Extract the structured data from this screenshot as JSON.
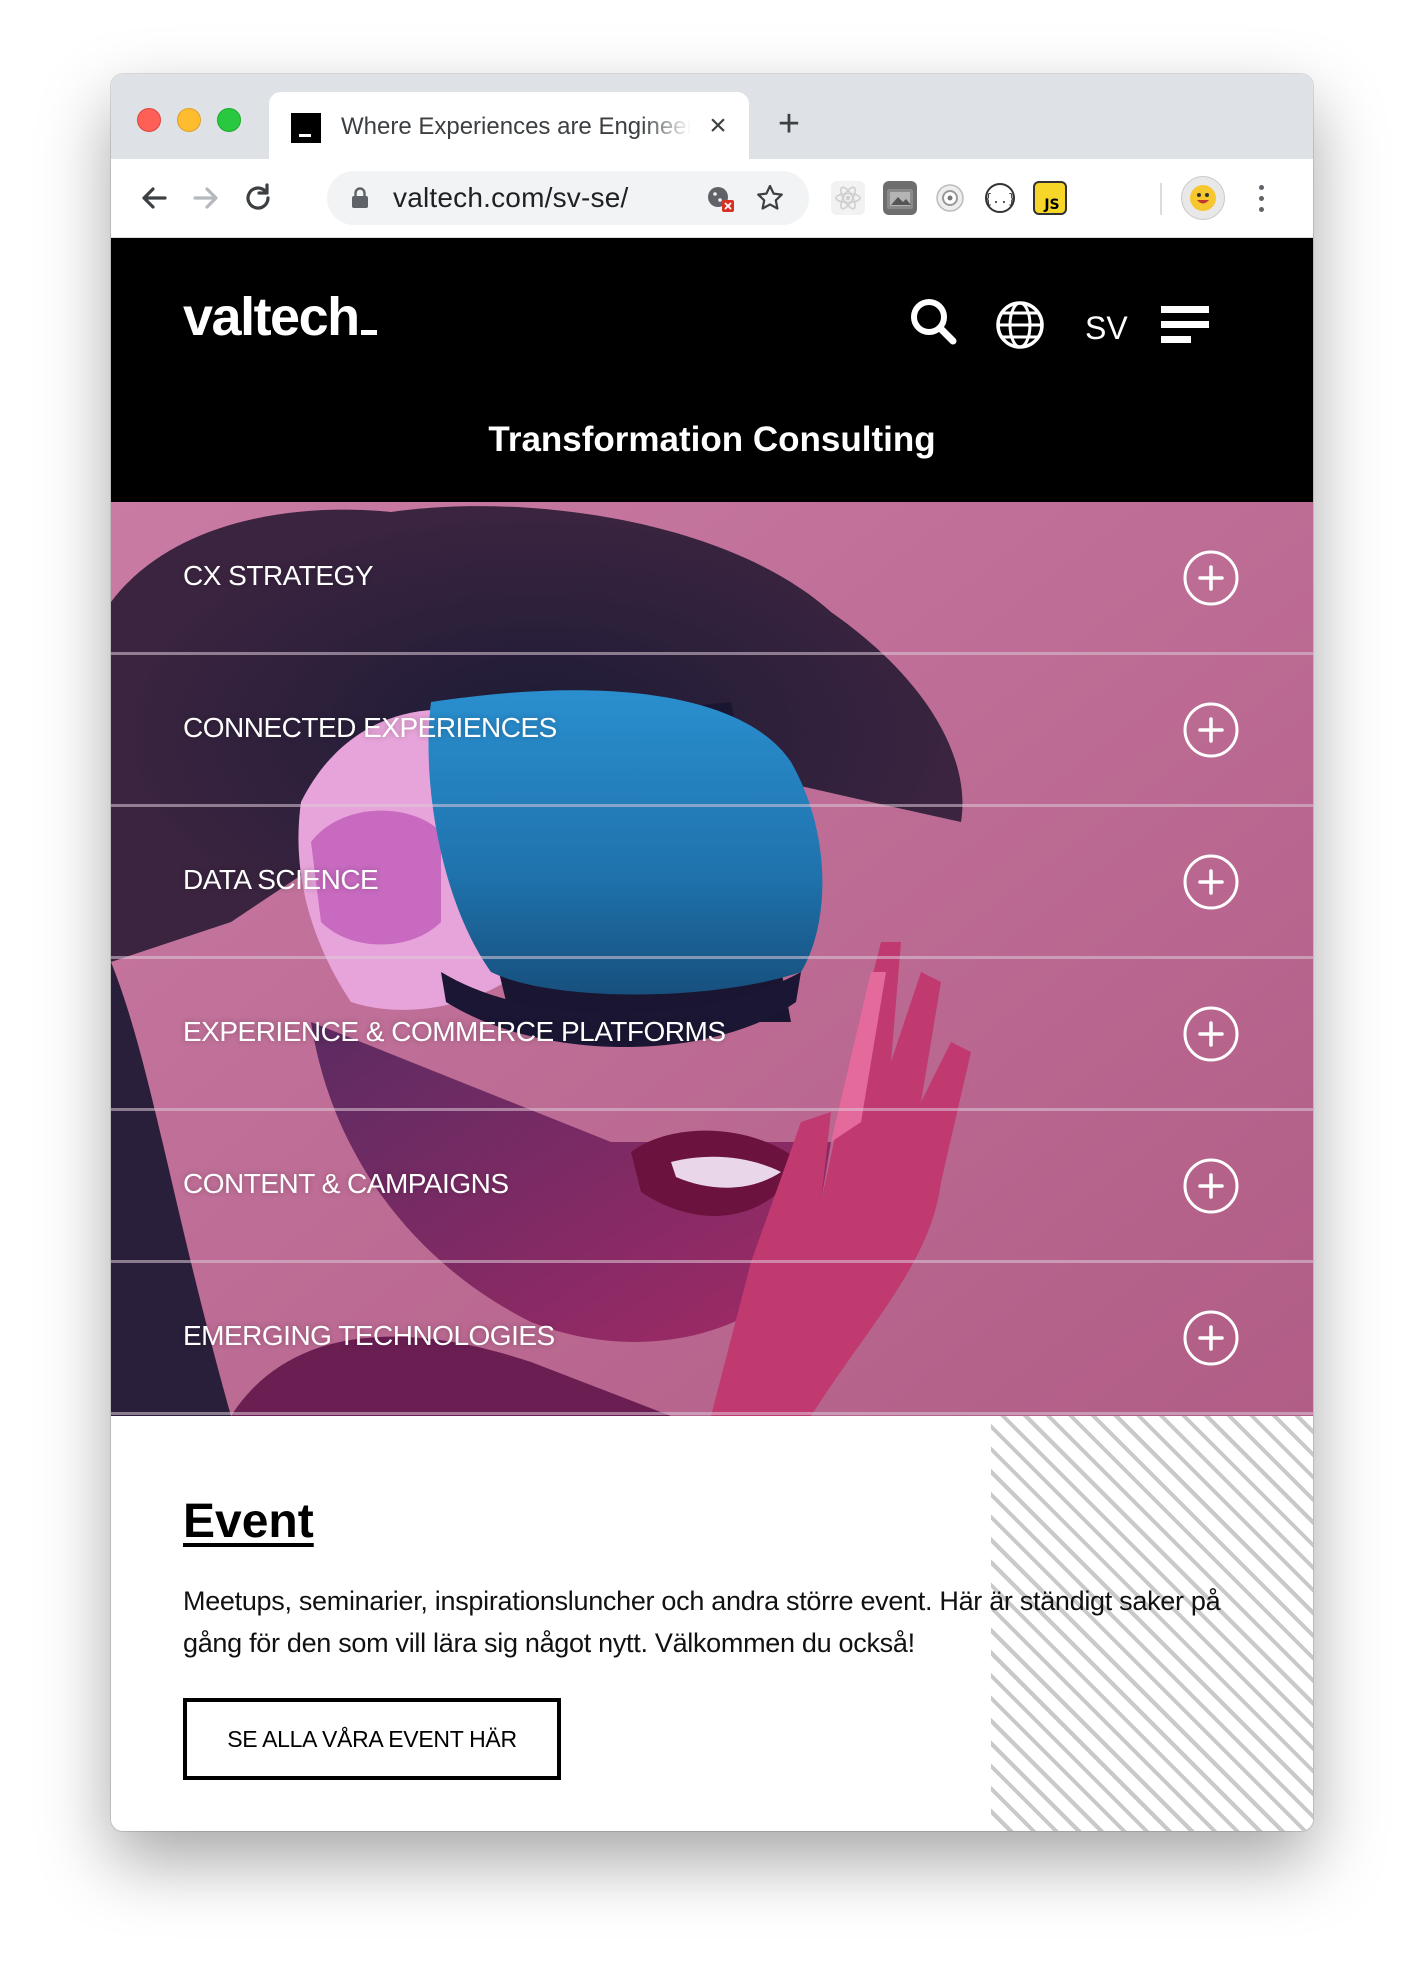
{
  "browser": {
    "tab_title": "Where Experiences are Engineered",
    "url": "valtech.com/sv-se/"
  },
  "site": {
    "logo": "valtech",
    "language": "SV",
    "section_title": "Transformation Consulting"
  },
  "accordion": {
    "items": [
      {
        "label": "CX STRATEGY"
      },
      {
        "label": "CONNECTED EXPERIENCES"
      },
      {
        "label": "DATA SCIENCE"
      },
      {
        "label": "EXPERIENCE & COMMERCE PLATFORMS"
      },
      {
        "label": "CONTENT & CAMPAIGNS"
      },
      {
        "label": "EMERGING TECHNOLOGIES"
      }
    ]
  },
  "event": {
    "title": "Event",
    "description": "Meetups, seminarier, inspirationsluncher och andra större event. Här är ständigt saker på gång för den som vill lära sig något nytt. Välkommen du också!",
    "button_label": "SE ALLA VÅRA EVENT HÄR"
  },
  "colors": {
    "header_bg": "#000000",
    "hero_pink": "#b9688f",
    "vr_blue": "#1b7bb5"
  }
}
